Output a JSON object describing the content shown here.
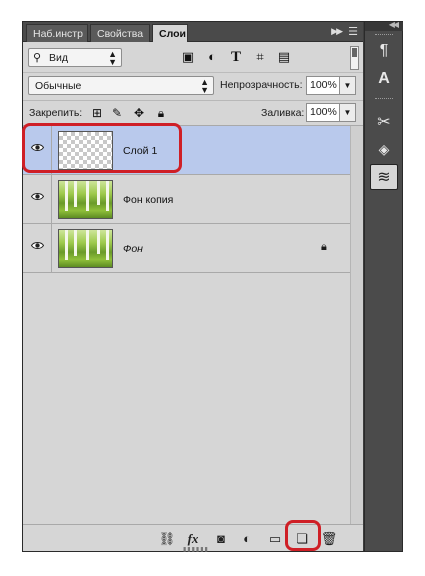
{
  "tabs": [
    {
      "label": "Наб.инстр",
      "active": false
    },
    {
      "label": "Свойства",
      "active": false
    },
    {
      "label": "Слои",
      "active": true
    }
  ],
  "filter": {
    "kind_label": "Вид",
    "icons": [
      "image-filter-icon",
      "adjustment-filter-icon",
      "type-filter-icon",
      "shape-filter-icon",
      "smart-object-filter-icon"
    ]
  },
  "blend": {
    "mode": "Обычные",
    "opacity_label": "Непрозрачность:",
    "opacity_value": "100%",
    "lock_label": "Закрепить:",
    "fill_label": "Заливка:",
    "fill_value": "100%"
  },
  "layers": [
    {
      "name": "Слой 1",
      "selected": true,
      "thumb": "transparent",
      "italic": false,
      "locked": false,
      "visible": true
    },
    {
      "name": "Фон копия",
      "selected": false,
      "thumb": "forest",
      "italic": false,
      "locked": false,
      "visible": true
    },
    {
      "name": "Фон",
      "selected": false,
      "thumb": "forest",
      "italic": true,
      "locked": true,
      "visible": true
    }
  ],
  "bottom_icons": [
    "link-layers-icon",
    "fx-icon",
    "add-mask-icon",
    "new-adjustment-icon",
    "new-group-icon",
    "new-layer-icon",
    "delete-layer-icon"
  ],
  "dock_icons": [
    "paragraph-style-icon",
    "character-style-icon",
    "tools-icon",
    "3d-icon",
    "layers-icon"
  ],
  "colors": {
    "selection": "#b9c9ec",
    "highlight": "#cf1f26",
    "panel": "#d6d6d6",
    "dock": "#4b4b4b"
  }
}
